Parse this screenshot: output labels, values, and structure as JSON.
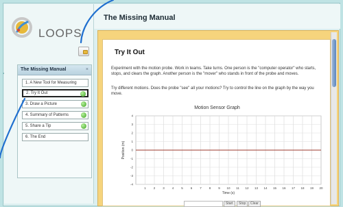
{
  "app": {
    "logo_text": "LOOPS"
  },
  "sidebar": {
    "toc_title": "The Missing Manual",
    "toc_close": "×",
    "items": [
      {
        "label": "1. A New Tool for Measuring"
      },
      {
        "label": "2. Try It Out"
      },
      {
        "label": "3. Draw a Picture"
      },
      {
        "label": "4. Summary of Patterns"
      },
      {
        "label": "5. Share a Tip"
      },
      {
        "label": "6. The End"
      }
    ]
  },
  "main": {
    "title": "The Missing Manual",
    "section_title": "Try It Out",
    "para1": "Experiment with the motion probe. Work in teams. Take turns. One person is the \"computer operator\" who starts, stops, and clears the graph. Another person is the \"mover\" who stands in front of the probe and moves.",
    "para2": "Try different motions. Does the probe \"see\" all your motions? Try to control the line on the graph by the way you move."
  },
  "graph": {
    "title": "Motion Sensor Graph",
    "controls": {
      "start": "Start",
      "stop": "Stop",
      "clear": "Clear"
    }
  },
  "chart_data": {
    "type": "line",
    "title": "Motion Sensor Graph",
    "xlabel": "Time (s)",
    "ylabel": "Position (m)",
    "xlim": [
      0,
      20
    ],
    "ylim": [
      -4,
      4
    ],
    "x_ticks": [
      1,
      2,
      3,
      4,
      5,
      6,
      7,
      8,
      9,
      10,
      11,
      12,
      13,
      14,
      15,
      16,
      17,
      18,
      19,
      20
    ],
    "y_ticks": [
      -4,
      -3,
      -2,
      -1,
      0,
      1,
      2,
      3,
      4
    ],
    "grid": true,
    "series": [
      {
        "x": [
          0,
          20
        ],
        "y": [
          0,
          0
        ],
        "color": "#9b3a2e"
      }
    ]
  },
  "colors": {
    "accent_blue": "#1f6fcf",
    "paper_yellow": "#f6d47d",
    "go_green": "#3ea322"
  }
}
